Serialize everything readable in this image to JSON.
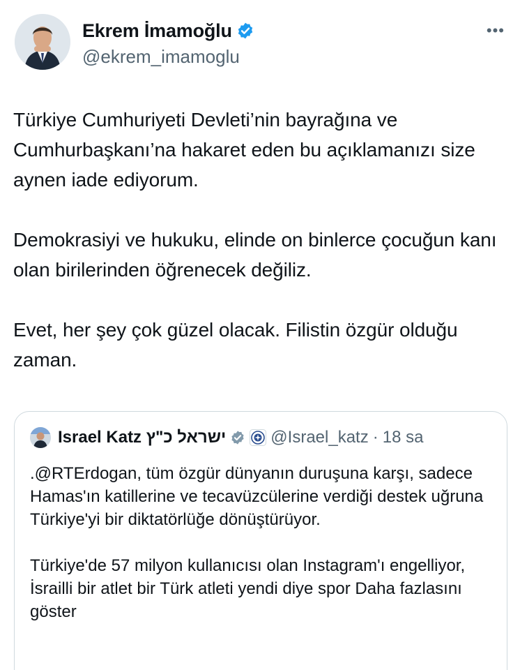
{
  "author": {
    "display_name": "Ekrem İmamoğlu",
    "handle": "@ekrem_imamoglu",
    "verified_color": "#1d9bf0",
    "avatar_icon": "profile-photo"
  },
  "menu": {
    "more_label": "•••"
  },
  "tweet": {
    "paragraphs": [
      "Türkiye Cumhuriyeti Devleti’nin bayrağına ve Cumhurbaşkanı’na hakaret eden bu açıklamanızı size aynen iade ediyorum.",
      "Demokrasiyi ve hukuku, elinde on binlerce çocuğun kanı olan birilerinden öğrenecek değiliz.",
      "Evet, her şey çok güzel olacak. Filistin özgür olduğu zaman."
    ]
  },
  "quote": {
    "display_name": "Israel Katz ישראל כ\"ץ",
    "handle": "@Israel_katz",
    "separator": "·",
    "time": "18 sa",
    "verified_color": "#829aab",
    "affiliation_icon": "government-seal",
    "paragraphs": [
      ".@RTErdogan, tüm özgür dünyanın duruşuna karşı, sadece Hamas'ın katillerine ve tecavüzcülerine verdiği destek uğruna Türkiye'yi bir diktatörlüğe dönüştürüyor.",
      "Türkiye'de 57 milyon kullanıcısı olan Instagram'ı engelliyor, İsrailli bir atlet bir Türk atleti yendi diye spor"
    ],
    "show_more": "Daha fazlasını göster"
  }
}
